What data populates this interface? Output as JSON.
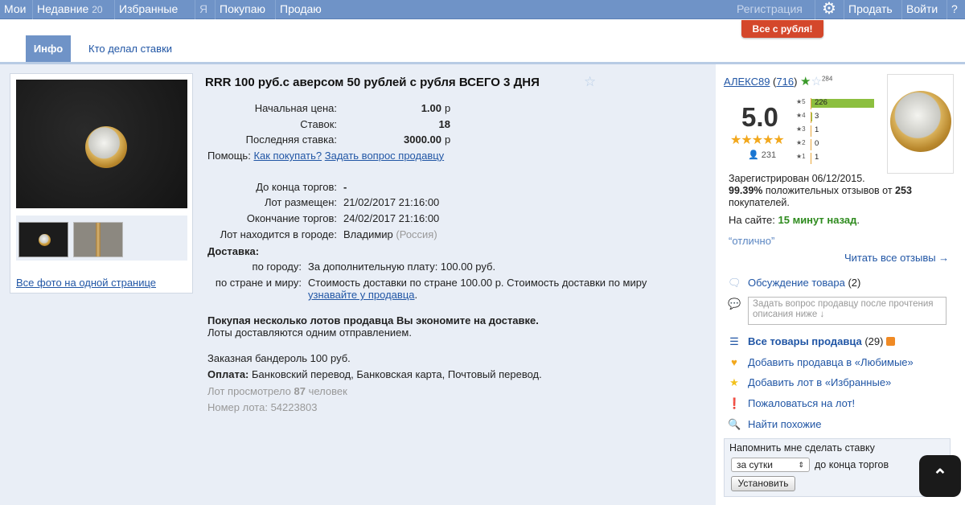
{
  "nav": {
    "items": [
      {
        "label": "Мои",
        "count": ""
      },
      {
        "label": "Недавние",
        "count": "20"
      },
      {
        "label": "Избранные",
        "count": ""
      },
      {
        "label": "Я",
        "count": ""
      },
      {
        "label": "Покупаю",
        "count": ""
      },
      {
        "label": "Продаю",
        "count": ""
      }
    ],
    "register": "Регистрация",
    "sell": "Продать",
    "login": "Войти",
    "help": "?",
    "settings_icon": "gear-icon",
    "promo": "Все с рубля!"
  },
  "tabs": {
    "info": "Инфо",
    "bids": "Кто делал ставки"
  },
  "gallery": {
    "all_photos": "Все фото на одной странице"
  },
  "lot": {
    "title": "RRR 100 руб.с аверсом 50 рублей с рубля ВСЕГО 3 ДНЯ",
    "start_price_label": "Начальная цена:",
    "start_price": "1.00",
    "currency": "р",
    "bids_label": "Ставок:",
    "bids": "18",
    "last_bid_label": "Последняя ставка:",
    "last_bid": "3000.00",
    "help_label": "Помощь:",
    "help_how": "Как покупать?",
    "help_ask": "Задать вопрос продавцу",
    "end_left_label": "До конца торгов:",
    "end_left": "-",
    "placed_label": "Лот размещен:",
    "placed": "21/02/2017 21:16:00",
    "ends_label": "Окончание торгов:",
    "ends": "24/02/2017 21:16:00",
    "city_label": "Лот находится в городе:",
    "city": "Владимир",
    "country": "(Россия)",
    "delivery_label": "Доставка:",
    "delivery_city_label": "по городу:",
    "delivery_city": "За дополнительную плату: 100.00 руб.",
    "delivery_world_label": "по стране и миру:",
    "delivery_world": "Стоимость доставки по стране 100.00 р. Стоимость доставки по миру",
    "delivery_world_link": "узнавайте у продавца",
    "save_bold": "Покупая несколько лотов продавца Вы экономите на доставке.",
    "save_text": "Лоты доставляются одним отправлением.",
    "parcel": "Заказная бандероль 100 руб.",
    "payment_label": "Оплата:",
    "payment": "Банковский перевод, Банковская карта, Почтовый перевод.",
    "views_pre": "Лот просмотрело",
    "views": "87",
    "views_post": "человек",
    "lot_number_label": "Номер лота:",
    "lot_number": "54223803"
  },
  "seller": {
    "name": "АЛЕКС89",
    "rating_count": "716",
    "favorites": "284",
    "score": "5.0",
    "reviews_total": "231",
    "dist": [
      {
        "star": "5",
        "count": "226",
        "fraction": 0.978
      },
      {
        "star": "4",
        "count": "3",
        "fraction": 0.013
      },
      {
        "star": "3",
        "count": "1",
        "fraction": 0.004
      },
      {
        "star": "2",
        "count": "0",
        "fraction": 0
      },
      {
        "star": "1",
        "count": "1",
        "fraction": 0.004
      }
    ],
    "registered": "Зарегистрирован 06/12/2015.",
    "positive_pct": "99.39%",
    "positive_text": "положительных отзывов от",
    "buyers": "253",
    "buyers_text": "покупателей.",
    "online_label": "На сайте:",
    "online": "15 минут назад",
    "quote": "“отлично”",
    "read_all": "Читать все отзывы →",
    "discuss": "Обсуждение товара",
    "discuss_count": "(2)",
    "ask_placeholder": "Задать вопрос продавцу после прочтения описания ниже ↓",
    "all_goods": "Все товары продавца",
    "all_goods_count": "(29)",
    "add_fav_seller": "Добавить продавца в «Любимые»",
    "add_fav_lot": "Добавить лот в «Избранные»",
    "complain": "Пожаловаться на лот!",
    "similar": "Найти похожие",
    "remind_title": "Напомнить мне сделать ставку",
    "remind_option": "за сутки",
    "remind_suffix": "до конца торгов",
    "remind_button": "Установить"
  },
  "colors": {
    "nav": "#6f93c7",
    "promo": "#d4472b",
    "bar": "#8cbf3f",
    "link": "#2156a5",
    "online": "#2e8b1e"
  }
}
